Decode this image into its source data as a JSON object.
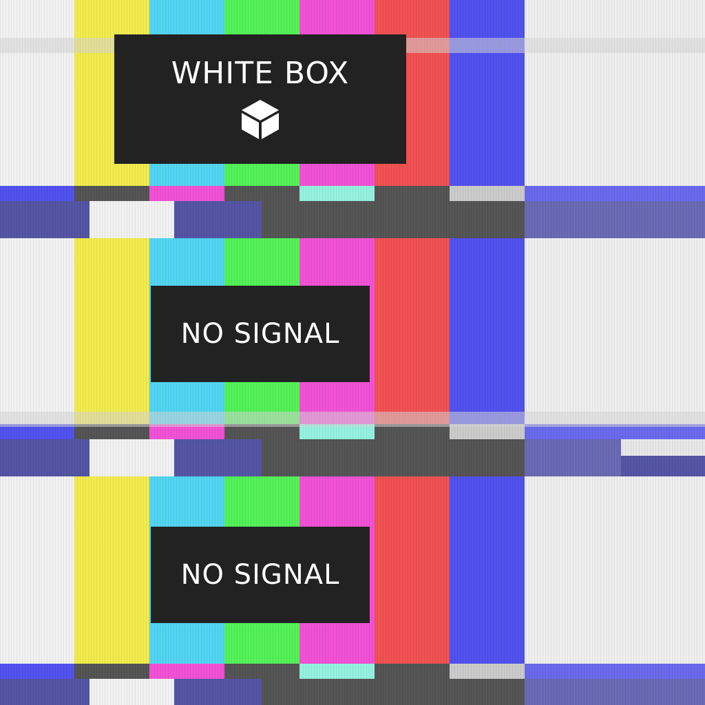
{
  "colors": {
    "white": "#f2f2f2",
    "yellow": "#f2ec4e",
    "cyan": "#52d6f2",
    "green": "#54f258",
    "magenta": "#f252d6",
    "red": "#f25252",
    "blue": "#5252f0",
    "dark": "#222222",
    "gray": "#555555",
    "mint": "#96f2e0",
    "light_gray": "#cccccc",
    "navy": "#5555a5"
  },
  "panels": [
    {
      "label": "WHITE BOX",
      "icon": "cube-icon"
    },
    {
      "label": "NO SIGNAL"
    },
    {
      "label": "NO SIGNAL"
    }
  ]
}
